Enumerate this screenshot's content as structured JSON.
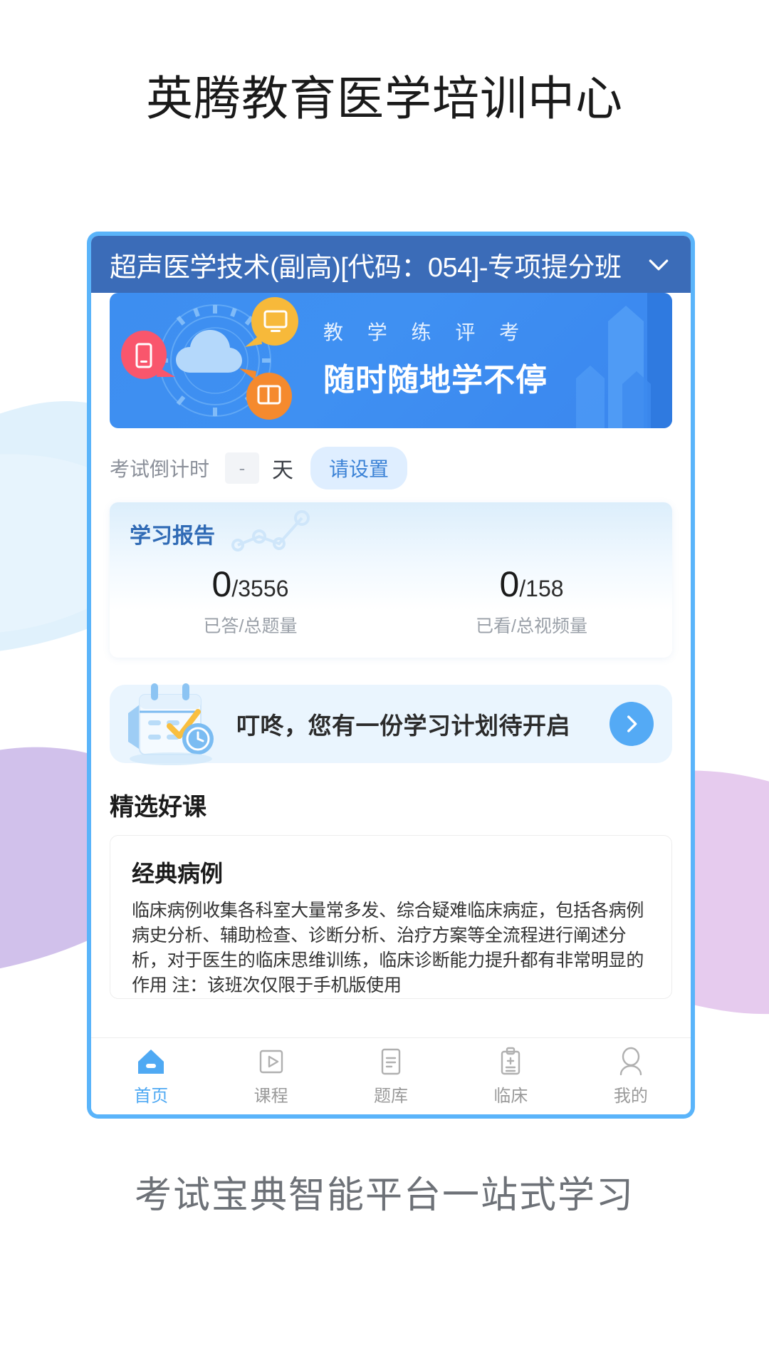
{
  "header": {
    "title": "英腾教育医学培训中心"
  },
  "footer": {
    "caption": "考试宝典智能平台一站式学习"
  },
  "app": {
    "titlebar": {
      "course_title": "超声医学技术(副高)[代码：054]-专项提分班",
      "chevron_icon": "chevron-down-icon"
    },
    "banner": {
      "line1": "教 学 练 评 考",
      "line2": "随时随地学不停"
    },
    "countdown": {
      "label": "考试倒计时",
      "days_value": "-",
      "unit": "天",
      "action_label": "请设置"
    },
    "report": {
      "title": "学习报告",
      "stats": [
        {
          "value": "0",
          "total": "/3556",
          "caption": "已答/总题量"
        },
        {
          "value": "0",
          "total": "/158",
          "caption": "已看/总视频量"
        }
      ]
    },
    "plan": {
      "text": "叮咚，您有一份学习计划待开启",
      "arrow_icon": "chevron-right-icon",
      "calendar_icon": "calendar-clock-icon"
    },
    "featured": {
      "section_title": "精选好课",
      "courses": [
        {
          "name": "经典病例",
          "description": "临床病例收集各科室大量常多发、综合疑难临床病症，包括各病例病史分析、辅助检查、诊断分析、治疗方案等全流程进行阐述分析，对于医生的临床思维训练，临床诊断能力提升都有非常明显的作用\n注：该班次仅限于手机版使用"
        }
      ]
    },
    "tabbar": {
      "items": [
        {
          "label": "首页",
          "icon": "home-icon",
          "active": true
        },
        {
          "label": "课程",
          "icon": "play-square-icon",
          "active": false
        },
        {
          "label": "题库",
          "icon": "question-bank-icon",
          "active": false
        },
        {
          "label": "临床",
          "icon": "clipboard-icon",
          "active": false
        },
        {
          "label": "我的",
          "icon": "user-icon",
          "active": false
        }
      ]
    }
  },
  "colors": {
    "frame": "#5ab4fa",
    "titlebar": "#3b6cb8",
    "accent": "#4fa9f3",
    "banner": "#3d8ef0",
    "report_title": "#2f6ab5",
    "blob_purple": "#c9b6e8",
    "blob_blue": "#daeefc"
  }
}
